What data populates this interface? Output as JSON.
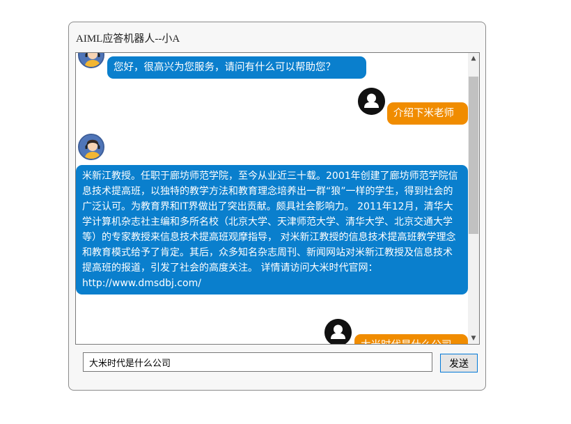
{
  "window": {
    "title": "AIML应答机器人--小A"
  },
  "messages": [
    {
      "sender": "bot",
      "text": "您好，很高兴为您服务，请问有什么可以帮助您？"
    },
    {
      "sender": "user",
      "text": "介绍下米老师"
    },
    {
      "sender": "bot",
      "text": "米新江教授。任职于廊坊师范学院，至今从业近三十载。2001年创建了廊坊师范学院信息技术提高班，以独特的教学方法和教育理念培养出一群“狼”一样的学生，得到社会的广泛认可。为教育界和IT界做出了突出贡献。颇具社会影响力。 2011年12月，清华大学计算机杂志社主编和多所名校（北京大学、天津师范大学、清华大学、北京交通大学等）的专家教授来信息技术提高班观摩指导， 对米新江教授的信息技术提高班教学理念和教育模式给予了肯定。其后，众多知名杂志周刊、新闻网站对米新江教授及信息技术提高班的报道，引发了社会的高度关注。 详情请访问大米时代官网：http://www.dmsdbj.com/"
    },
    {
      "sender": "user",
      "text": "大米时代是什么公司"
    }
  ],
  "input": {
    "value": "大米时代是什么公司"
  },
  "send_label": "发送",
  "icons": {
    "bot_avatar": "customer-service-avatar-icon",
    "user_avatar": "user-avatar-icon"
  },
  "colors": {
    "bot_bubble": "#0a7fcd",
    "user_bubble": "#f08c00"
  }
}
